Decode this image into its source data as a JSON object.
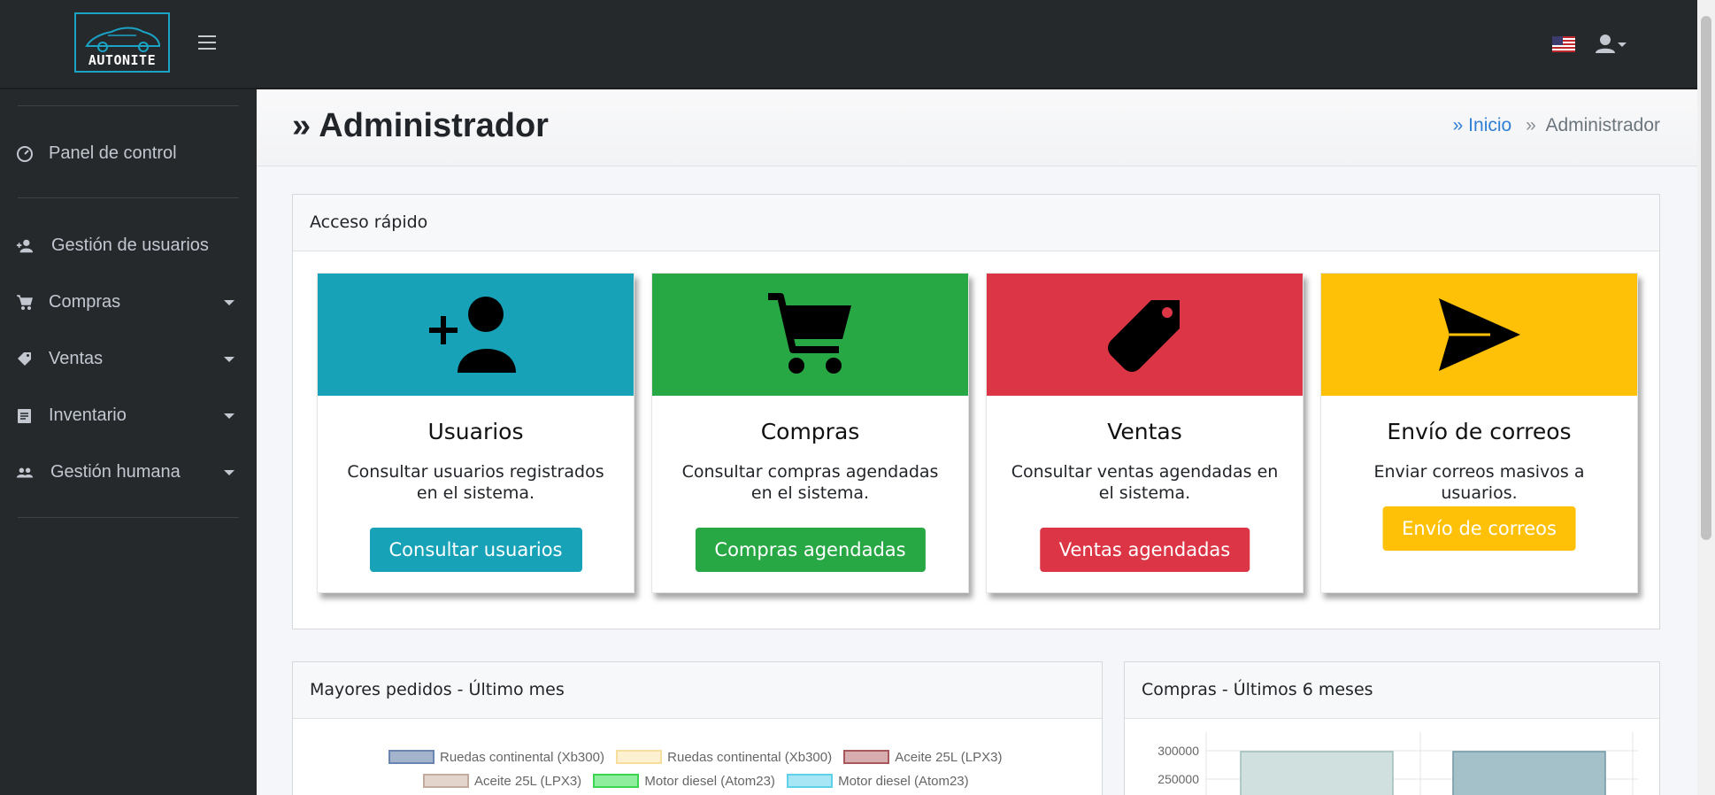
{
  "brand": {
    "name": "AUTONITE",
    "accent": "#1aa3c4"
  },
  "header": {
    "flag": "us-flag-icon",
    "user_icon": "user-dropdown-icon"
  },
  "sidebar": {
    "items": [
      {
        "label": "Panel de control",
        "icon": "dashboard-icon",
        "has_submenu": false
      },
      {
        "label": "Gestión de usuarios",
        "icon": "add-user-icon",
        "has_submenu": false
      },
      {
        "label": "Compras",
        "icon": "cart-icon",
        "has_submenu": true
      },
      {
        "label": "Ventas",
        "icon": "tag-icon",
        "has_submenu": true
      },
      {
        "label": "Inventario",
        "icon": "document-icon",
        "has_submenu": true
      },
      {
        "label": "Gestión humana",
        "icon": "group-icon",
        "has_submenu": true
      }
    ]
  },
  "page": {
    "title": "» Administrador",
    "breadcrumb": {
      "home": "» Inicio",
      "separator": "»",
      "current": "Administrador"
    }
  },
  "quick_access": {
    "title": "Acceso rápido",
    "tiles": [
      {
        "title": "Usuarios",
        "description": "Consultar usuarios registrados en el sistema.",
        "button": "Consultar usuarios",
        "color": "#17a2b8",
        "icon": "add-user-icon"
      },
      {
        "title": "Compras",
        "description": "Consultar compras agendadas en el sistema.",
        "button": "Compras agendadas",
        "color": "#28a745",
        "icon": "cart-icon"
      },
      {
        "title": "Ventas",
        "description": "Consultar ventas agendadas en el sistema.",
        "button": "Ventas agendadas",
        "color": "#dc3545",
        "icon": "tag-icon"
      },
      {
        "title": "Envío de correos",
        "description": "Enviar correos masivos a usuarios.",
        "button": "Envío de correos",
        "color": "#ffc107",
        "icon": "send-icon"
      }
    ]
  },
  "chart_orders": {
    "title": "Mayores pedidos - Último mes",
    "legend": [
      {
        "label": "Ruedas continental (Xb300)",
        "fill": "#a3b4cc",
        "border": "#6a86b0"
      },
      {
        "label": "Ruedas continental (Xb300)",
        "fill": "#fdf1d2",
        "border": "#f7de9c"
      },
      {
        "label": "Aceite 25L (LPX3)",
        "fill": "#d6aeb0",
        "border": "#a8585c"
      },
      {
        "label": "Aceite 25L (LPX3)",
        "fill": "#e3d4cc",
        "border": "#c4ab9f"
      },
      {
        "label": "Motor diesel (Atom23)",
        "fill": "#8eee9d",
        "border": "#3bd64f"
      },
      {
        "label": "Motor diesel (Atom23)",
        "fill": "#a6e6f5",
        "border": "#60cfea"
      }
    ]
  },
  "chart_data": {
    "type": "bar",
    "title": "Compras - Últimos 6 meses",
    "y_ticks": [
      "300000",
      "250000"
    ],
    "ylim_visible": [
      250000,
      300000
    ]
  }
}
